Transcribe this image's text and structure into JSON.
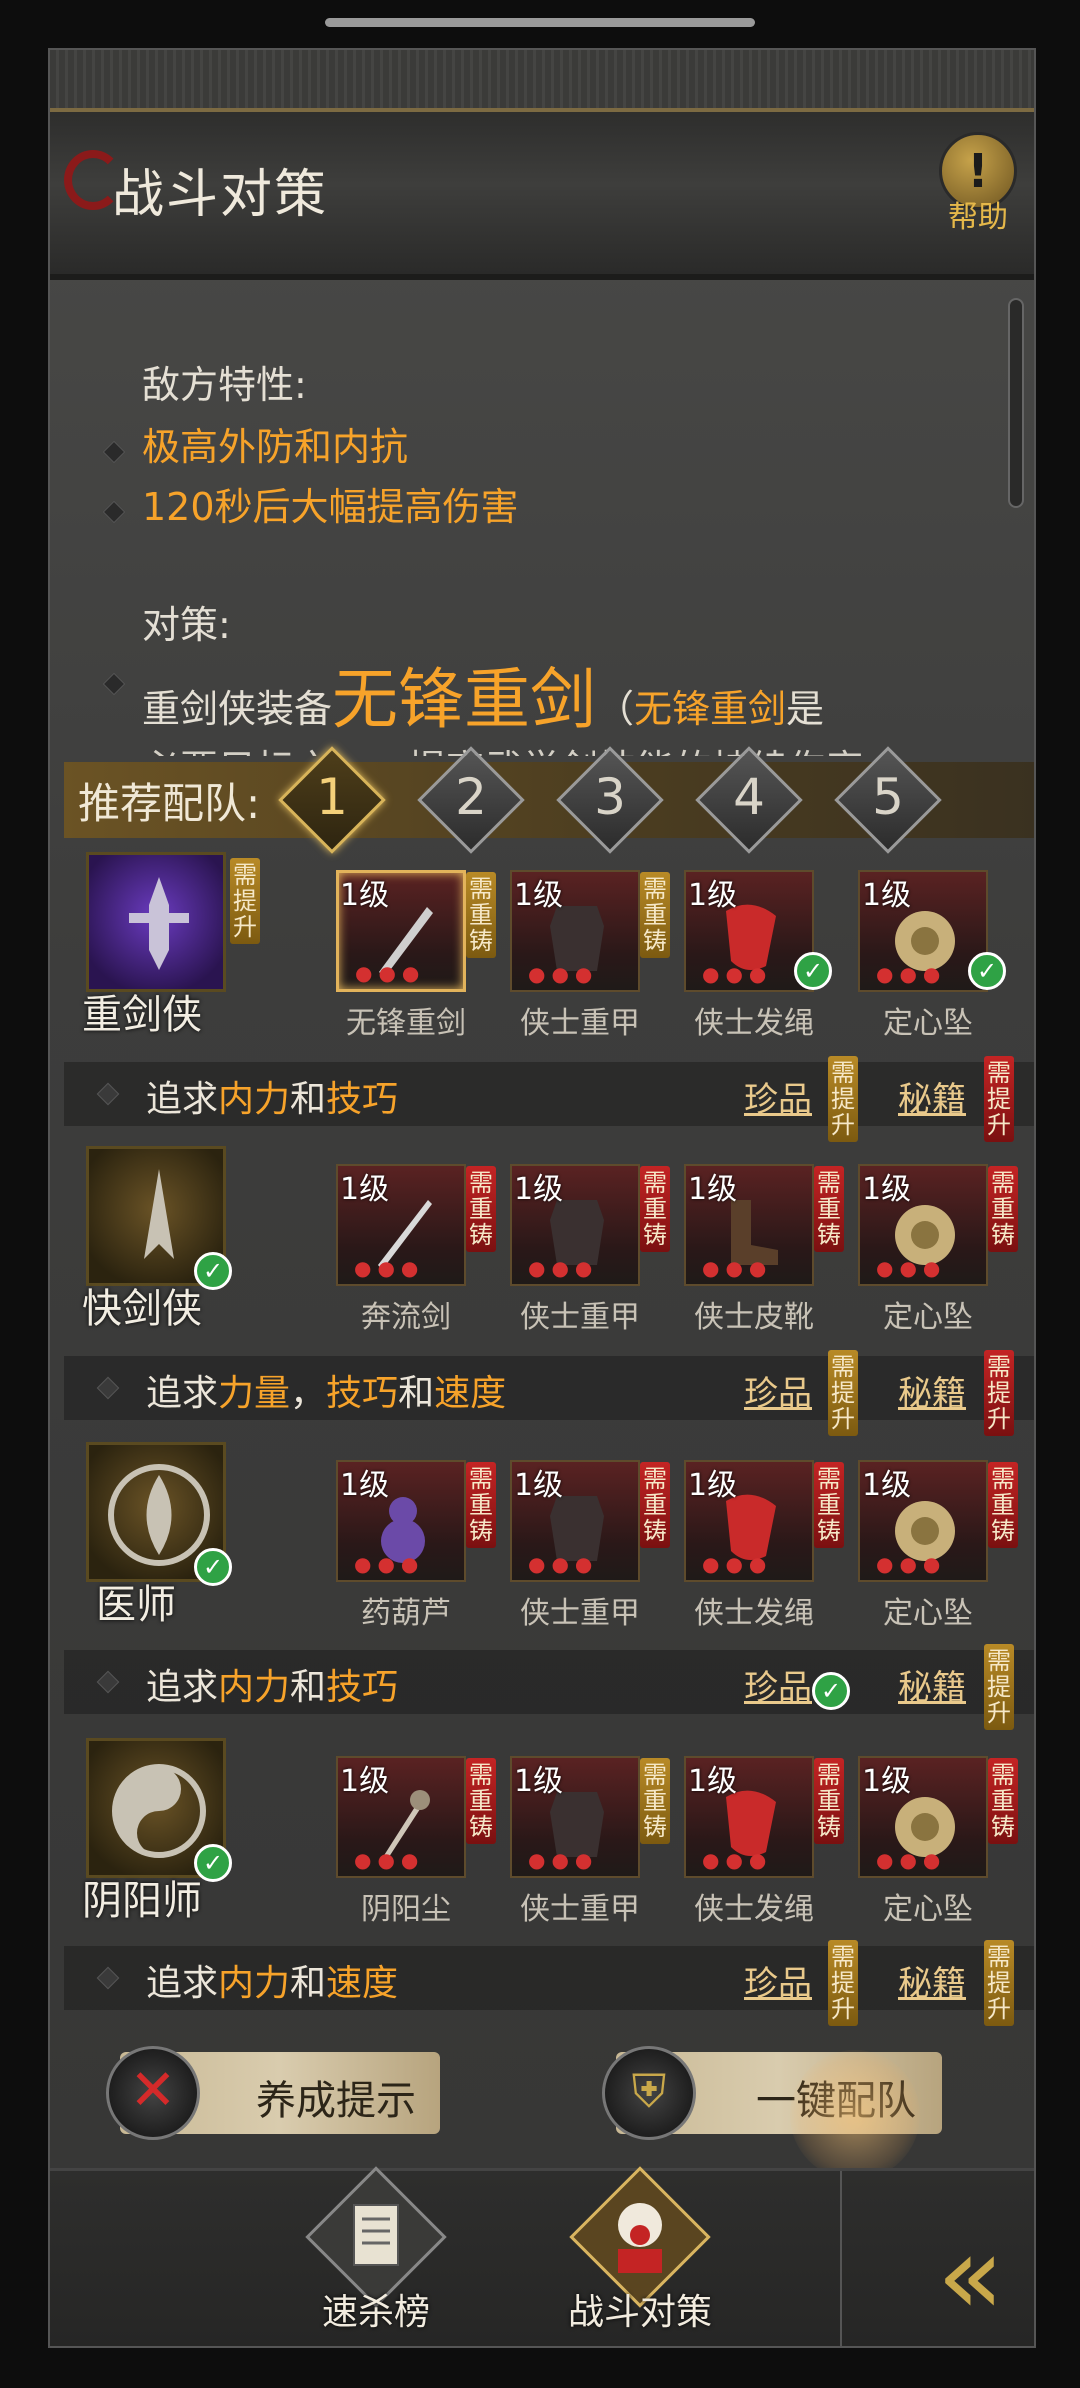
{
  "header": {
    "title": "战斗对策",
    "help_label": "帮助",
    "help_glyph": "!"
  },
  "info": {
    "enemy_label": "敌方特性:",
    "enemy_traits": [
      "极高外防和内抗",
      "120秒后大幅提高伤害"
    ],
    "strategy_label": "对策:",
    "strategy_prefix": "重剑侠装备",
    "strategy_weapon": "无锋重剑",
    "strategy_paren_open": "（",
    "strategy_weapon_ref": "无锋重剑",
    "strategy_suffix": "是",
    "strategy_next_line": "必要目标之一，提高武学剑技能的持续伤害"
  },
  "team": {
    "label": "推荐配队:",
    "tabs": [
      "1",
      "2",
      "3",
      "4",
      "5"
    ],
    "active_tab": "1"
  },
  "tags": {
    "need_upgrade": "需提升",
    "need_recast": "需重铸"
  },
  "characters": [
    {
      "name": "重剑侠",
      "equips": [
        {
          "level": "1级",
          "name": "无锋重剑"
        },
        {
          "level": "1级",
          "name": "侠士重甲"
        },
        {
          "level": "1级",
          "name": "侠士发绳"
        },
        {
          "level": "1级",
          "name": "定心坠"
        }
      ],
      "pursuit": {
        "prefix": "追求",
        "a": "内力",
        "mid": "和",
        "b": "技巧",
        "c": ""
      },
      "treasure": "珍品",
      "manual": "秘籍"
    },
    {
      "name": "快剑侠",
      "equips": [
        {
          "level": "1级",
          "name": "奔流剑"
        },
        {
          "level": "1级",
          "name": "侠士重甲"
        },
        {
          "level": "1级",
          "name": "侠士皮靴"
        },
        {
          "level": "1级",
          "name": "定心坠"
        }
      ],
      "pursuit": {
        "prefix": "追求",
        "a": "力量",
        "mid": "，",
        "b": "技巧",
        "mid2": "和",
        "c": "速度"
      },
      "treasure": "珍品",
      "manual": "秘籍"
    },
    {
      "name": "医师",
      "equips": [
        {
          "level": "1级",
          "name": "药葫芦"
        },
        {
          "level": "1级",
          "name": "侠士重甲"
        },
        {
          "level": "1级",
          "name": "侠士发绳"
        },
        {
          "level": "1级",
          "name": "定心坠"
        }
      ],
      "pursuit": {
        "prefix": "追求",
        "a": "内力",
        "mid": "和",
        "b": "技巧",
        "c": ""
      },
      "treasure": "珍品",
      "manual": "秘籍"
    },
    {
      "name": "阴阳师",
      "equips": [
        {
          "level": "1级",
          "name": "阴阳尘"
        },
        {
          "level": "1级",
          "name": "侠士重甲"
        },
        {
          "level": "1级",
          "name": "侠士发绳"
        },
        {
          "level": "1级",
          "name": "定心坠"
        }
      ],
      "pursuit": {
        "prefix": "追求",
        "a": "内力",
        "mid": "和",
        "b": "速度",
        "c": ""
      },
      "treasure": "珍品",
      "manual": "秘籍"
    }
  ],
  "buttons": {
    "hint": "养成提示",
    "auto_team": "一键配队"
  },
  "nav": {
    "speedkill": "速杀榜",
    "strategy": "战斗对策"
  },
  "colors": {
    "accent_orange": "#f7a32a",
    "check_green": "#2fa245",
    "need_red": "#c42424",
    "need_gold": "#b88a26"
  }
}
